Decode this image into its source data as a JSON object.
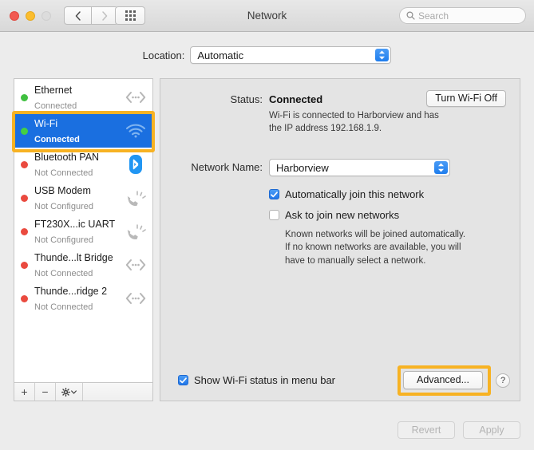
{
  "window": {
    "title": "Network",
    "traffic_lights": [
      "close",
      "minimize",
      "zoom"
    ],
    "nav": {
      "back": "back-arrow",
      "forward": "forward-arrow"
    },
    "grid_button": "show-all-preferences",
    "search": {
      "placeholder": "Search",
      "value": "",
      "icon": "search-icon"
    }
  },
  "location": {
    "label": "Location:",
    "value": "Automatic",
    "options": [
      "Automatic"
    ]
  },
  "sidebar": {
    "services": [
      {
        "name": "Ethernet",
        "status": "Connected",
        "dot": "green",
        "icon": "ethernet-icon"
      },
      {
        "name": "Wi-Fi",
        "status": "Connected",
        "dot": "green",
        "icon": "wifi-icon",
        "selected": true
      },
      {
        "name": "Bluetooth PAN",
        "status": "Not Connected",
        "dot": "red",
        "icon": "bluetooth-icon"
      },
      {
        "name": "USB Modem",
        "status": "Not Configured",
        "dot": "red",
        "icon": "modem-icon"
      },
      {
        "name": "FT230X...ic UART",
        "status": "Not Configured",
        "dot": "red",
        "icon": "modem-icon"
      },
      {
        "name": "Thunde...lt Bridge",
        "status": "Not Connected",
        "dot": "red",
        "icon": "ethernet-icon"
      },
      {
        "name": "Thunde...ridge 2",
        "status": "Not Connected",
        "dot": "red",
        "icon": "ethernet-icon"
      }
    ],
    "footer": {
      "add": "+",
      "remove": "−",
      "actions": "gear-icon"
    }
  },
  "main": {
    "status_label": "Status:",
    "status_value": "Connected",
    "turn_wifi_label": "Turn Wi-Fi Off",
    "status_description": "Wi-Fi is connected to Harborview and has the IP address 192.168.1.9.",
    "network_name_label": "Network Name:",
    "network_name_value": "Harborview",
    "network_name_options": [
      "Harborview"
    ],
    "auto_join": {
      "label": "Automatically join this network",
      "checked": true
    },
    "ask_join": {
      "label": "Ask to join new networks",
      "checked": false
    },
    "ask_join_note": "Known networks will be joined automatically. If no known networks are available, you will have to manually select a network.",
    "show_status": {
      "label": "Show Wi-Fi status in menu bar",
      "checked": true
    },
    "advanced_label": "Advanced...",
    "help_label": "?"
  },
  "footer": {
    "revert_label": "Revert",
    "revert_enabled": false,
    "apply_label": "Apply",
    "apply_enabled": false
  },
  "colors": {
    "selection_blue": "#1a6fe0",
    "highlight_amber": "#f7b223",
    "status_green": "#40c040",
    "status_red": "#ea4a3f",
    "accent_blue": "#2176e8"
  }
}
